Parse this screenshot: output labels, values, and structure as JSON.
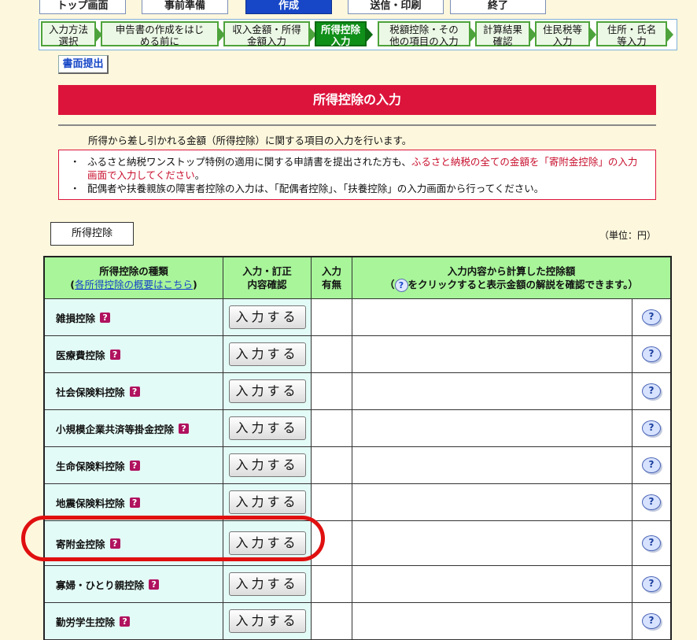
{
  "top_tabs": [
    "トップ画面",
    "事前準備",
    "作成",
    "送信・印刷",
    "終了"
  ],
  "steps": [
    {
      "label": "入力方法\n選択",
      "active": false
    },
    {
      "label": "申告書の作成をはじ\nめる前に",
      "active": false
    },
    {
      "label": "収入金額・所得\n金額入力",
      "active": false
    },
    {
      "label": "所得控除\n入力",
      "active": true
    },
    {
      "label": "税額控除・その\n他の項目の入力",
      "active": false
    },
    {
      "label": "計算結果\n確認",
      "active": false
    },
    {
      "label": "住民税等\n入力",
      "active": false
    },
    {
      "label": "住所・氏名\n等入力",
      "active": false
    }
  ],
  "submit_label": "書面提出",
  "page_title": "所得控除の入力",
  "intro": "所得から差し引かれる金額（所得控除）に関する項目の入力を行います。",
  "notice": {
    "line1_pre": "ふるさと納税ワンストップ特例の適用に関する申請書を提出された方も、",
    "line1_red": "ふるさと納税の全ての金額を「寄附金控除」の入力画面で入力してください",
    "line1_post": "。",
    "line2": "配偶者や扶養親族の障害者控除の入力は、「配偶者控除」、「扶養控除」の入力画面から行ってください。",
    "bullet": "・"
  },
  "section_label": "所得控除",
  "unit": "（単位：円）",
  "table": {
    "h1_title": "所得控除の種類",
    "h1_link": "各所得控除の概要はこちら",
    "h2": "入力・訂正\n内容確認",
    "h3": "入力\n有無",
    "h4_title": "入力内容から計算した控除額",
    "h4_pre": "（",
    "h4_post": "をクリックすると表示金額の解説を確認できます。）",
    "button_label": "入力する",
    "rows": [
      "雑損控除",
      "医療費控除",
      "社会保険料控除",
      "小規模企業共済等掛金控除",
      "生命保険料控除",
      "地震保険料控除",
      "寄附金控除",
      "寡婦・ひとり親控除",
      "勤労学生控除"
    ]
  },
  "accent_red": "#dc143c",
  "header_green": "#a8f59a"
}
